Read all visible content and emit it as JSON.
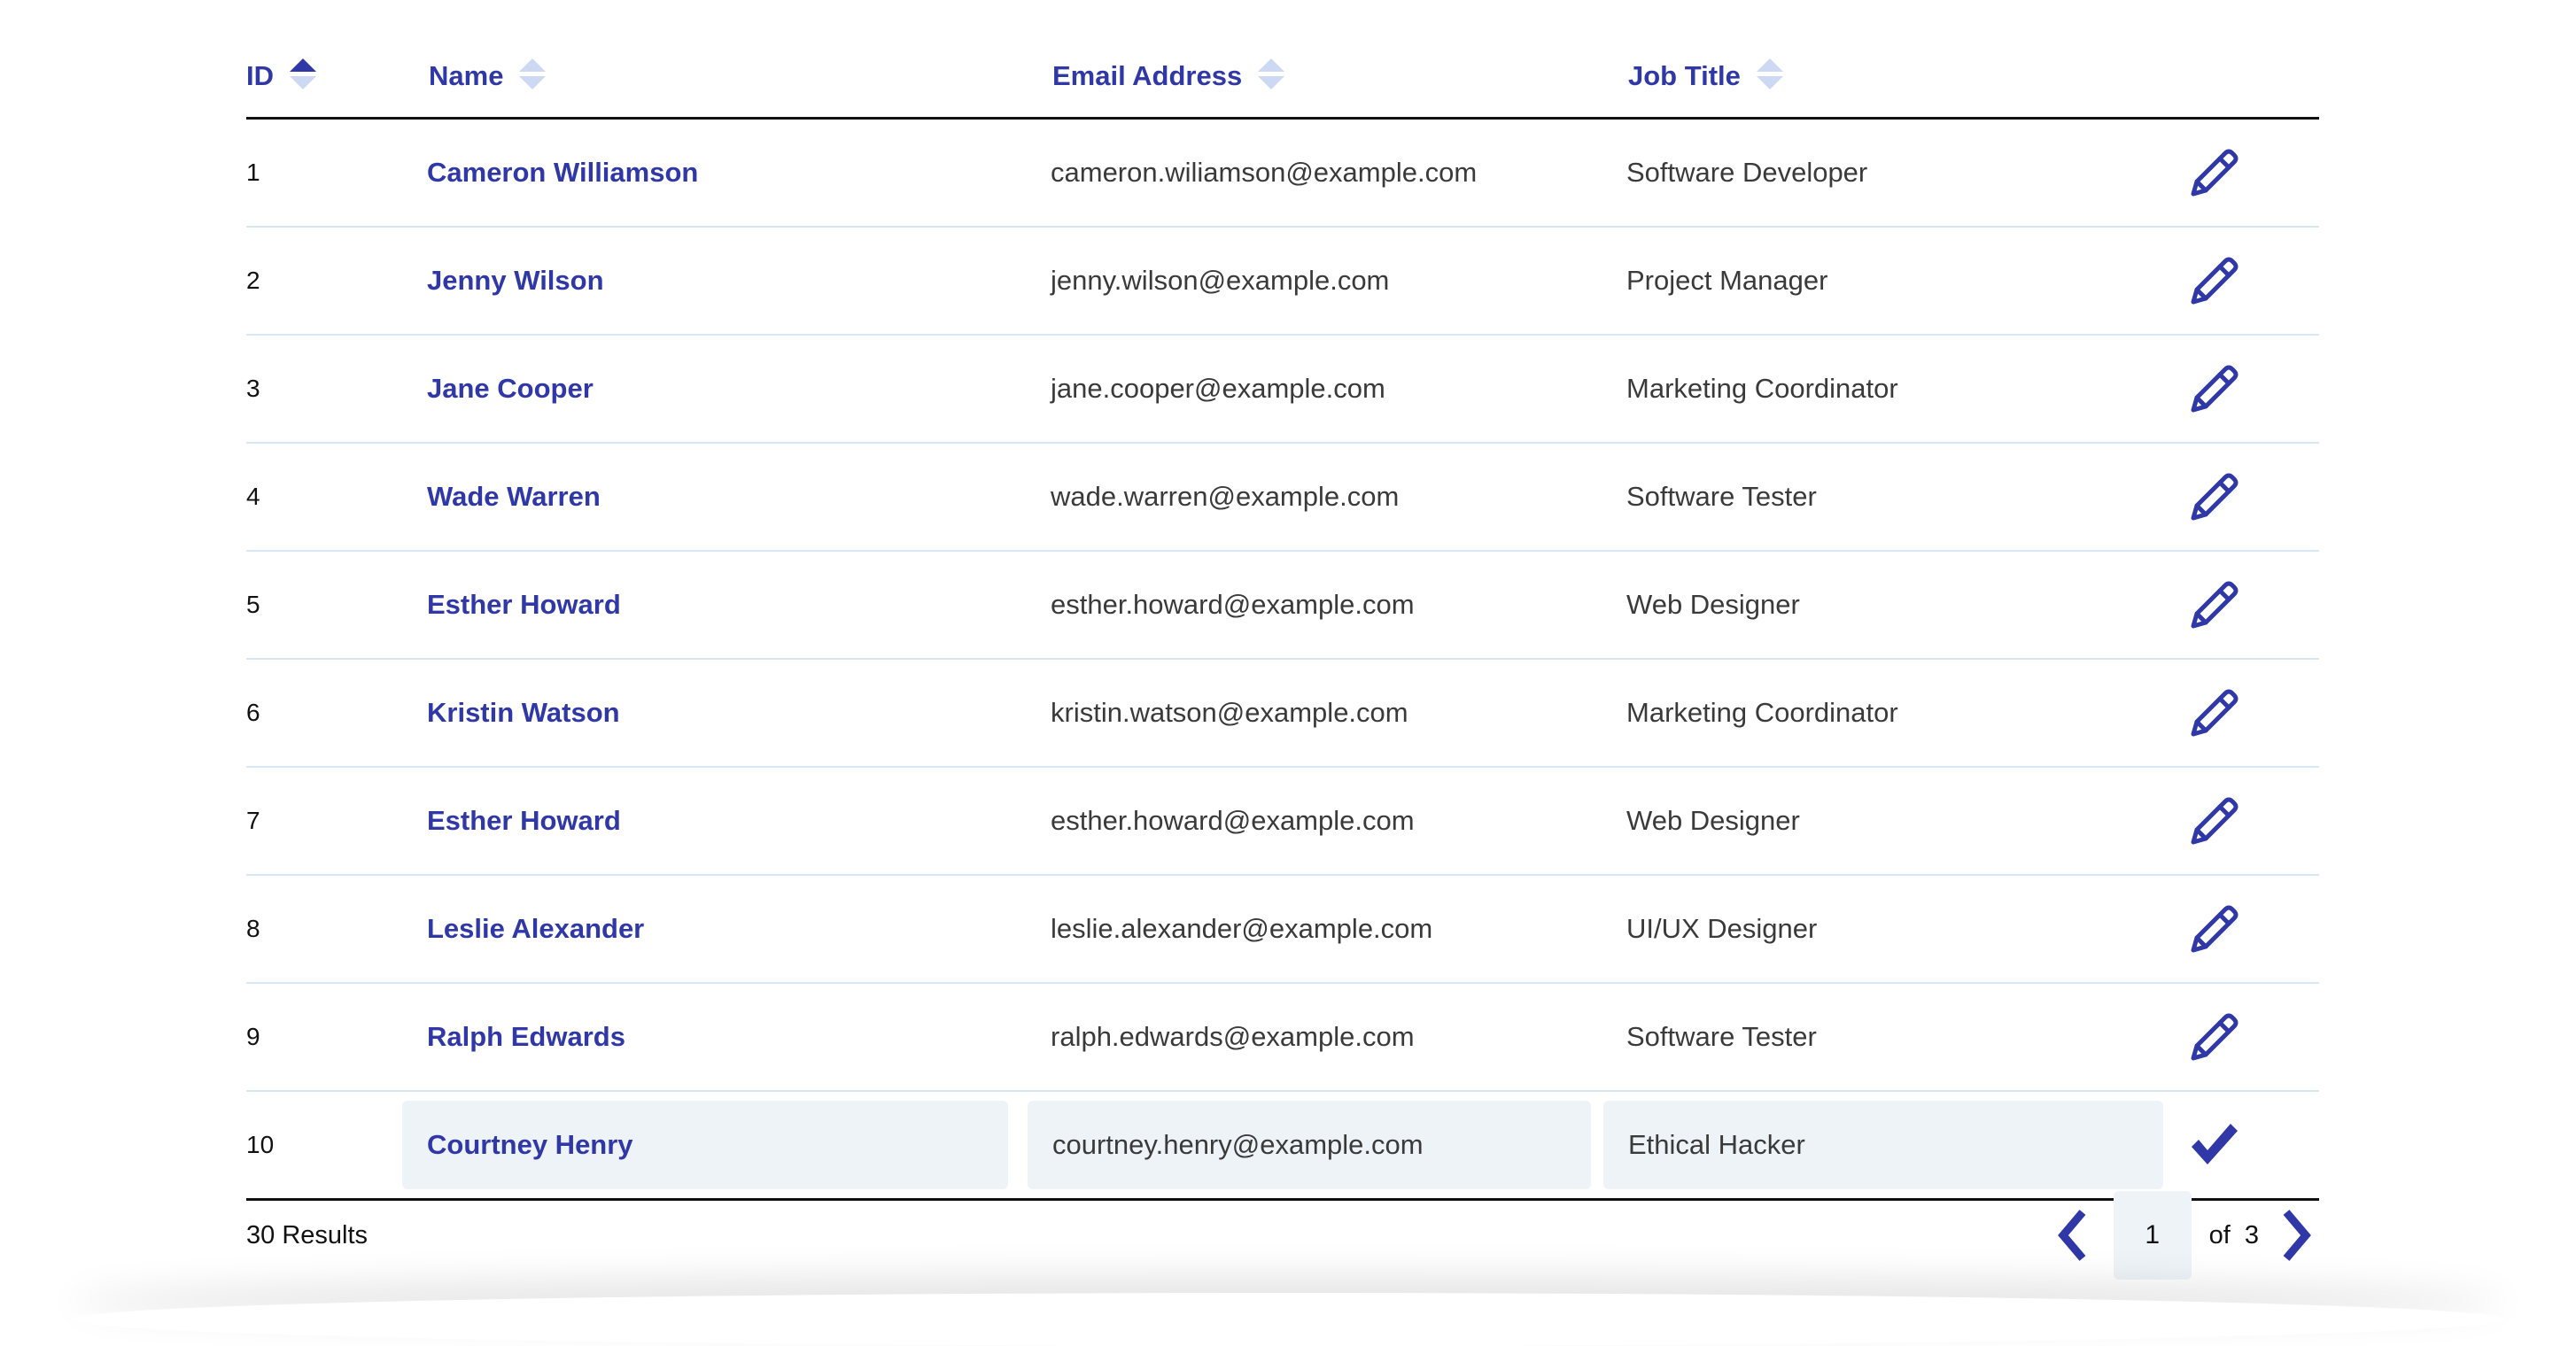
{
  "headers": {
    "id": "ID",
    "name": "Name",
    "email": "Email Address",
    "job": "Job Title"
  },
  "rows": [
    {
      "id": "1",
      "name": "Cameron Williamson",
      "email": "cameron.wiliamson@example.com",
      "job": "Software Developer",
      "action": "pencil-icon"
    },
    {
      "id": "2",
      "name": "Jenny Wilson",
      "email": "jenny.wilson@example.com",
      "job": "Project Manager",
      "action": "pencil-icon"
    },
    {
      "id": "3",
      "name": "Jane Cooper",
      "email": "jane.cooper@example.com",
      "job": "Marketing Coordinator",
      "action": "pencil-icon"
    },
    {
      "id": "4",
      "name": "Wade Warren",
      "email": "wade.warren@example.com",
      "job": "Software Tester",
      "action": "pencil-icon"
    },
    {
      "id": "5",
      "name": "Esther Howard",
      "email": "esther.howard@example.com",
      "job": "Web Designer",
      "action": "pencil-icon"
    },
    {
      "id": "6",
      "name": "Kristin Watson",
      "email": "kristin.watson@example.com",
      "job": "Marketing Coordinator",
      "action": "pencil-icon"
    },
    {
      "id": "7",
      "name": "Esther Howard",
      "email": "esther.howard@example.com",
      "job": "Web Designer",
      "action": "pencil-icon"
    },
    {
      "id": "8",
      "name": "Leslie Alexander",
      "email": "leslie.alexander@example.com",
      "job": "UI/UX Designer",
      "action": "pencil-icon"
    },
    {
      "id": "9",
      "name": "Ralph Edwards",
      "email": "ralph.edwards@example.com",
      "job": "Software Tester",
      "action": "pencil-icon"
    },
    {
      "id": "10",
      "name": "Courtney Henry",
      "email": "courtney.henry@example.com",
      "job": "Ethical Hacker",
      "action": "check-icon"
    }
  ],
  "footer": {
    "results": "30 Results",
    "current_page": "1",
    "of_label": "of",
    "total_pages": "3"
  },
  "colors": {
    "accent": "#2f38a6",
    "sort_inactive": "#cdd8f2",
    "row_divider": "#d9e6f5",
    "edit_bg": "#eef3f8",
    "text": "#3a3a3a"
  },
  "icons": {
    "sort": "sort-arrows-icon",
    "prev": "chevron-left-icon",
    "next": "chevron-right-icon"
  }
}
